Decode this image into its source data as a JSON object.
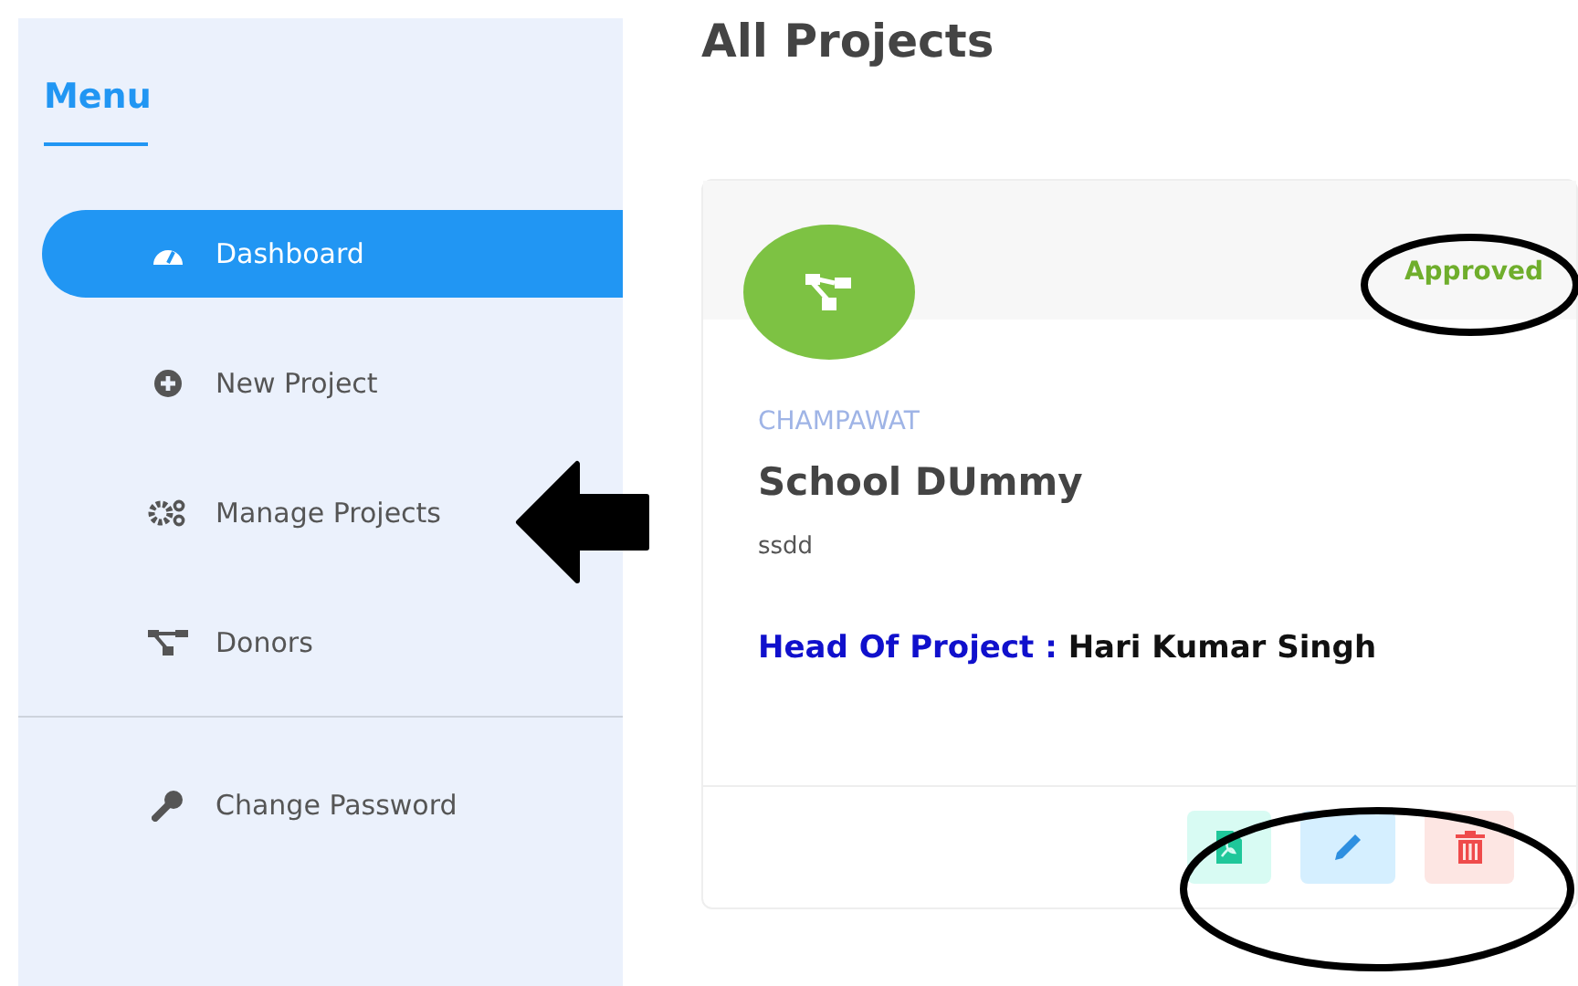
{
  "sidebar": {
    "title": "Menu",
    "items": [
      {
        "label": "Dashboard",
        "kind": "gauge",
        "selected": true
      },
      {
        "label": "New Project",
        "kind": "plus",
        "selected": false
      },
      {
        "label": "Manage Projects",
        "kind": "gears",
        "selected": false
      },
      {
        "label": "Donors",
        "kind": "sitemap",
        "selected": false
      }
    ],
    "footer_items": [
      {
        "label": "Change Password",
        "kind": "key",
        "selected": false
      }
    ]
  },
  "page_title": "All Projects",
  "project_card": {
    "status": "Approved",
    "location": "CHAMPAWAT",
    "title": "School DUmmy",
    "description": "ssdd",
    "head_label": "Head Of Project :",
    "head_name": "Hari Kumar Singh",
    "actions": [
      {
        "kind": "pdf"
      },
      {
        "kind": "edit"
      },
      {
        "kind": "delete"
      }
    ]
  }
}
